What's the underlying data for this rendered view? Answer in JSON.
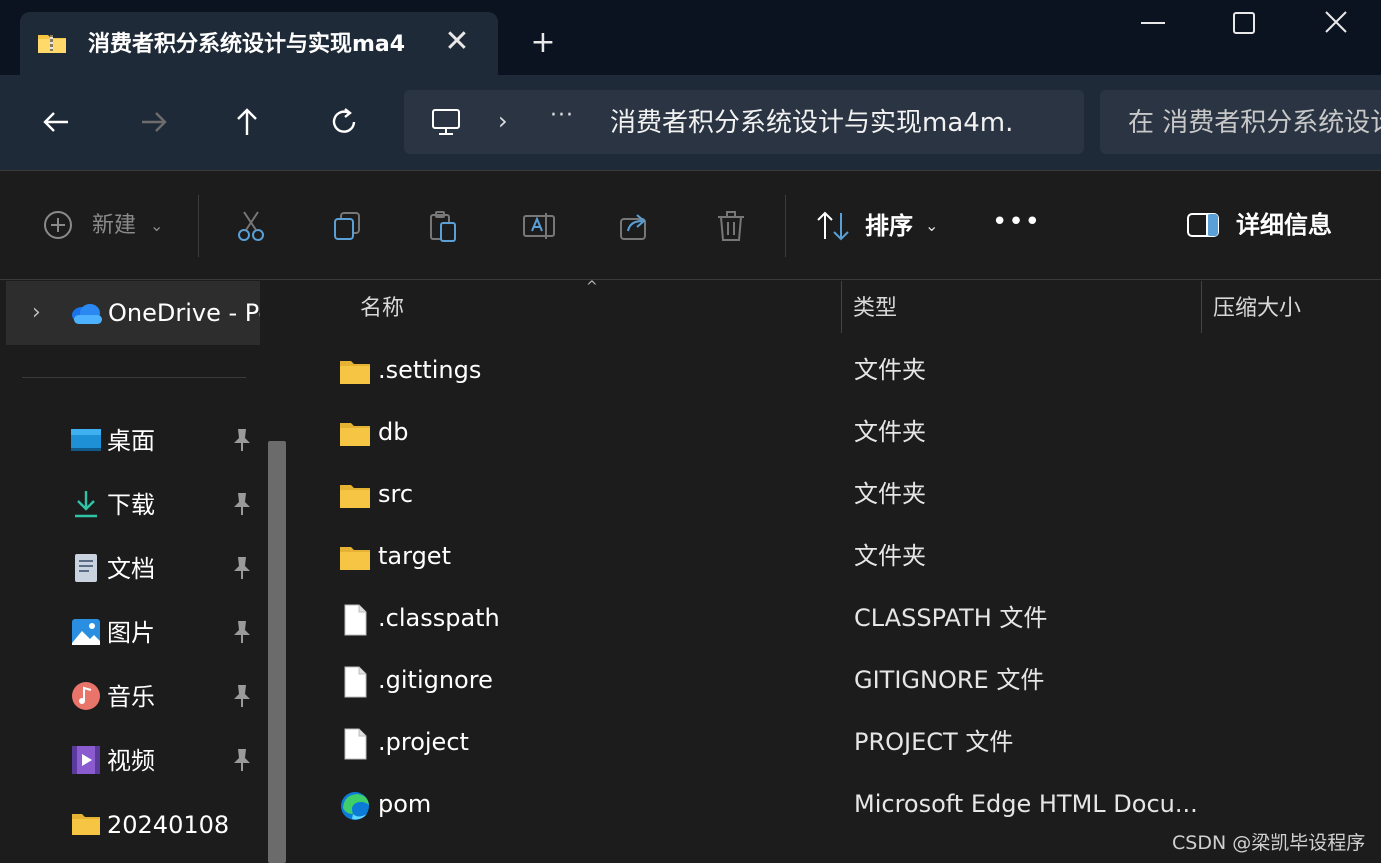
{
  "tab": {
    "title": "消费者积分系统设计与实现ma4",
    "close_glyph": "✕",
    "new_tab_glyph": "+"
  },
  "address_bar": {
    "chevron": "›",
    "more": "···",
    "path": "消费者积分系统设计与实现ma4m."
  },
  "search": {
    "placeholder": "在 消费者积分系统设计"
  },
  "command_bar": {
    "new_label": "新建",
    "sort_label": "排序",
    "more_label": "•••",
    "details_label": "详细信息",
    "dropdown_glyph": "⌄"
  },
  "sidebar": {
    "onedrive_label": "OneDrive - Pe",
    "expand_glyph": "›",
    "items": [
      {
        "label": "桌面",
        "icon": "desktop-icon"
      },
      {
        "label": "下载",
        "icon": "download-icon"
      },
      {
        "label": "文档",
        "icon": "document-icon"
      },
      {
        "label": "图片",
        "icon": "pictures-icon"
      },
      {
        "label": "音乐",
        "icon": "music-icon"
      },
      {
        "label": "视频",
        "icon": "video-icon"
      },
      {
        "label": "20240108",
        "icon": "folder-icon"
      }
    ]
  },
  "columns": {
    "name": "名称",
    "type": "类型",
    "size": "压缩大小",
    "sort_caret": "^"
  },
  "files": [
    {
      "name": ".settings",
      "type": "文件夹",
      "icon": "folder-icon"
    },
    {
      "name": "db",
      "type": "文件夹",
      "icon": "folder-icon"
    },
    {
      "name": "src",
      "type": "文件夹",
      "icon": "folder-icon"
    },
    {
      "name": "target",
      "type": "文件夹",
      "icon": "folder-icon"
    },
    {
      "name": ".classpath",
      "type": "CLASSPATH 文件",
      "icon": "file-icon"
    },
    {
      "name": ".gitignore",
      "type": "GITIGNORE 文件",
      "icon": "file-icon"
    },
    {
      "name": ".project",
      "type": "PROJECT 文件",
      "icon": "file-icon"
    },
    {
      "name": "pom",
      "type": "Microsoft Edge HTML Docu...",
      "icon": "edge-icon"
    }
  ],
  "watermark": "CSDN @梁凯毕设程序",
  "colors": {
    "tabbar_bg": "#0b1220",
    "navbar_bg": "#1f2a38",
    "content_bg": "#1c1c1c",
    "folder_yellow": "#f6c544",
    "accent_blue": "#4cc2ff"
  }
}
